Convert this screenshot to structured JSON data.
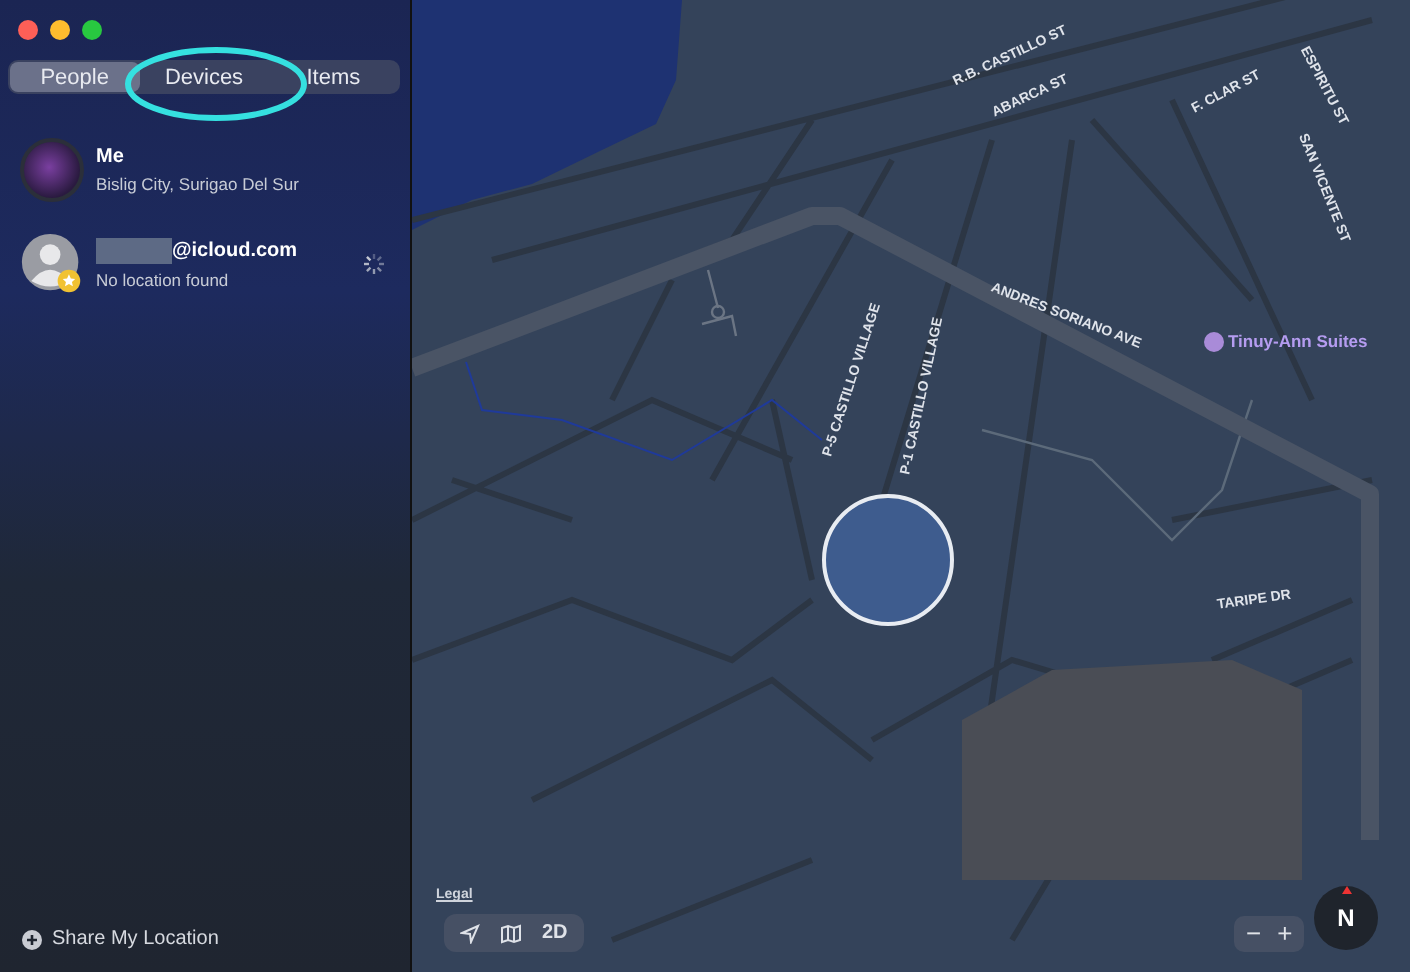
{
  "tabs": [
    {
      "label": "People",
      "selected": true
    },
    {
      "label": "Devices",
      "selected": false
    },
    {
      "label": "Items",
      "selected": false
    }
  ],
  "people": [
    {
      "kind": "self",
      "name": "Me",
      "detail": "Bislig City, Surigao Del Sur",
      "loading": false
    },
    {
      "kind": "contact",
      "name": "@icloud.com",
      "detail": "No location found",
      "loading": true
    }
  ],
  "share_button": {
    "label": "Share My Location"
  },
  "map": {
    "labels": [
      {
        "kind": "street",
        "text": "R.B. CASTILLO ST"
      },
      {
        "kind": "street",
        "text": "ABARCA ST"
      },
      {
        "kind": "street",
        "text": "F. CLAR ST"
      },
      {
        "kind": "street",
        "text": "ESPIRITU ST"
      },
      {
        "kind": "street",
        "text": "SAN VICENTE ST"
      },
      {
        "kind": "street",
        "text": "ANDRES SORIANO AVE"
      },
      {
        "kind": "poi",
        "text": "Tinuy-Ann Suites"
      },
      {
        "kind": "street",
        "text": "P-5 CASTILLO VILLAGE"
      },
      {
        "kind": "street",
        "text": "P-1 CASTILLO VILLAGE"
      },
      {
        "kind": "street",
        "text": "TARIPE DR"
      }
    ],
    "legal_link": "Legal",
    "mode_button": "2D",
    "zoom_out": "−",
    "zoom_in": "+",
    "compass": "N"
  }
}
